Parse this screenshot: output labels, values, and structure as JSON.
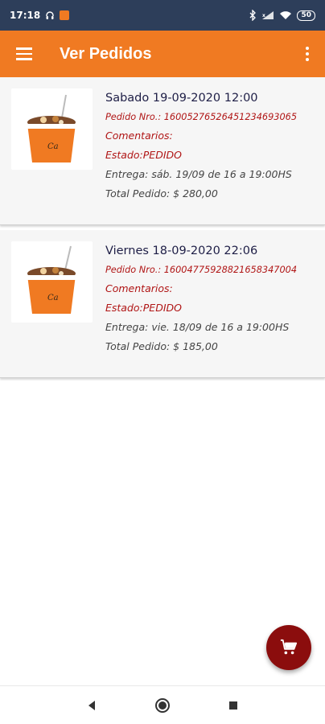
{
  "status_bar": {
    "time": "17:18",
    "battery": "50"
  },
  "app_bar": {
    "title": "Ver Pedidos"
  },
  "orders": [
    {
      "date": "Sabado 19-09-2020 12:00",
      "number": "Pedido Nro.: 16005276526451234693065",
      "comments": "Comentarios:",
      "status": "Estado:PEDIDO",
      "delivery": "Entrega: sáb. 19/09 de  16 a 19:00HS",
      "total": "Total Pedido: $ 280,00"
    },
    {
      "date": "Viernes 18-09-2020 22:06",
      "number": "Pedido Nro.: 16004775928821658347004",
      "comments": "Comentarios:",
      "status": "Estado:PEDIDO",
      "delivery": "Entrega: vie. 18/09 de  16 a 19:00HS",
      "total": "Total Pedido: $ 185,00"
    }
  ],
  "colors": {
    "primary": "#f07a22",
    "status_bar": "#2d3e5a",
    "accent": "#8b0d0d",
    "red_text": "#b01515"
  },
  "icons": {
    "menu": "menu-icon",
    "overflow": "more-vert-icon",
    "fab": "cart-icon",
    "nav_back": "back-icon",
    "nav_home": "home-icon",
    "nav_recents": "recents-icon"
  }
}
